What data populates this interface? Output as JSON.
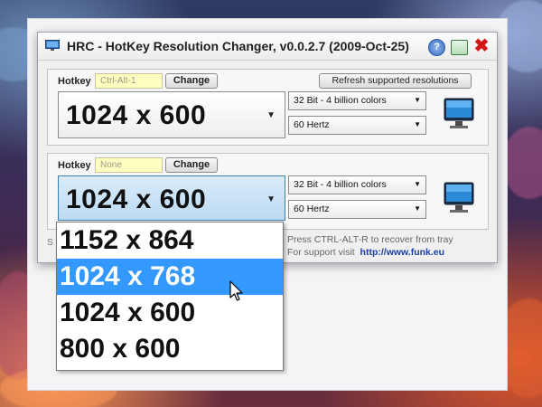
{
  "window": {
    "title": "HRC - HotKey Resolution Changer, v0.0.2.7 (2009-Oct-25)",
    "icons": [
      "monitor-icon",
      "help-icon",
      "tray-icon",
      "close-icon"
    ]
  },
  "profile1": {
    "hotkey_label": "Hotkey",
    "hotkey_value": "Ctrl-Alt-1",
    "change_label": "Change",
    "refresh_label": "Refresh supported resolutions",
    "resolution": "1024 x 600",
    "color_depth": "32 Bit - 4 billion colors",
    "refresh_rate": "60 Hertz"
  },
  "profile2": {
    "hotkey_label": "Hotkey",
    "hotkey_value": "None",
    "change_label": "Change",
    "resolution": "1024 x 600",
    "color_depth": "32 Bit - 4 billion colors",
    "refresh_rate": "60 Hertz"
  },
  "footer": {
    "status_letter": "S",
    "recover_text": "Press CTRL-ALT-R to recover from tray",
    "support_text": "For support visit",
    "support_link": "http://www.funk.eu"
  },
  "dropdown": {
    "options": [
      "1152 x 864",
      "1024 x 768",
      "1024 x 600",
      "800 x 600"
    ],
    "highlighted": "1024 x 768"
  },
  "colors": {
    "highlight": "#3399ff",
    "hotkey_field": "#ffffc0",
    "active_combo": "#bcdaf3"
  }
}
